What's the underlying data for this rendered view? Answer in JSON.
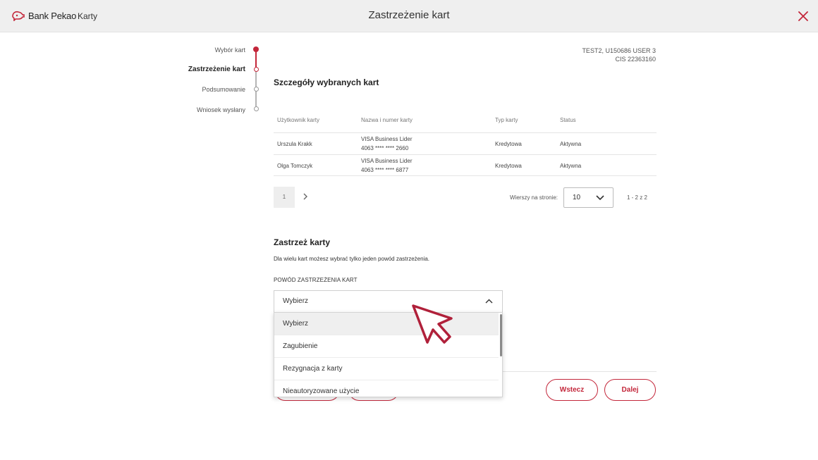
{
  "header": {
    "brand": "Bank Pekao",
    "section": "Karty",
    "title": "Zastrzeżenie kart"
  },
  "colors": {
    "accent": "#c3263a",
    "header_bg": "#efefef"
  },
  "stepper": {
    "steps": [
      {
        "label": "Wybór kart",
        "state": "done"
      },
      {
        "label": "Zastrzeżenie kart",
        "state": "active"
      },
      {
        "label": "Podsumowanie",
        "state": "todo"
      },
      {
        "label": "Wniosek wysłany",
        "state": "todo"
      }
    ]
  },
  "user": {
    "line1": "TEST2, U150686 USER 3",
    "line2": "CIS 22363160"
  },
  "details": {
    "title": "Szczegóły wybranych kart",
    "columns": [
      "Użytkownik karty",
      "Nazwa i numer karty",
      "Typ karty",
      "Status"
    ],
    "rows": [
      {
        "user": "Urszula Krakk",
        "card_name": "VISA Business Lider",
        "card_number": "4063 **** **** 2660",
        "type": "Kredytowa",
        "status": "Aktywna"
      },
      {
        "user": "Olga Tomczyk",
        "card_name": "VISA Business Lider",
        "card_number": "4063 **** **** 6877",
        "type": "Kredytowa",
        "status": "Aktywna"
      }
    ],
    "pagination": {
      "page": "1",
      "rows_label": "Wierszy na stronie:",
      "rows_value": "10",
      "range": "1 - 2 z 2"
    }
  },
  "block": {
    "title": "Zastrzeż karty",
    "description": "Dla wielu kart możesz wybrać tylko jeden powód zastrzeżenia.",
    "field_label": "POWÓD ZASTRZEŻENIA KART",
    "select_value": "Wybierz",
    "options": [
      "Wybierz",
      "Zagubienie",
      "Rezygnacja z karty",
      "Nieautoryzowane użycie"
    ]
  },
  "actions": {
    "back": "Wstecz",
    "next": "Dalej"
  }
}
